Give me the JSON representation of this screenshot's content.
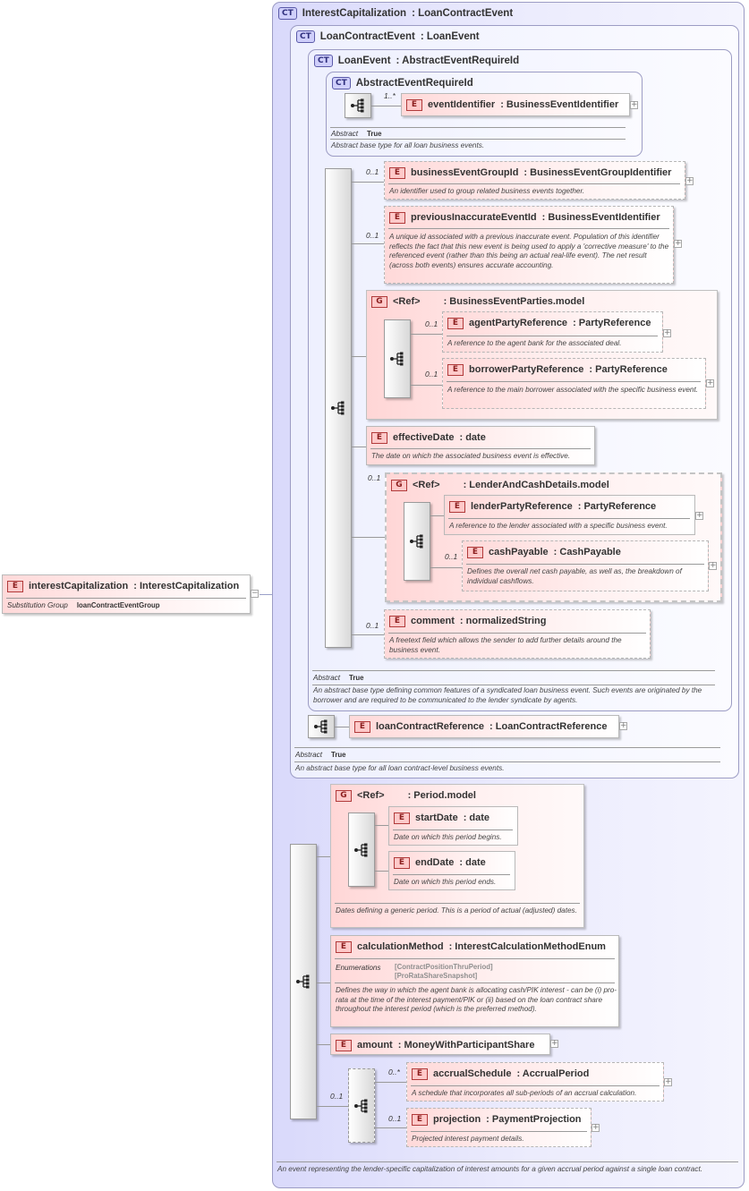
{
  "root": {
    "badge": "E",
    "name": "interestCapitalization",
    "type": ": InterestCapitalization",
    "subst_label": "Substitution Group",
    "subst_value": "loanContractEventGroup",
    "toggle": "−"
  },
  "ct_interest": {
    "badge": "CT",
    "name": "InterestCapitalization",
    "base": ": LoanContractEvent",
    "desc": "An event representing the lender-specific capitalization of interest amounts for a given accrual period against a single loan contract."
  },
  "ct_loancontract": {
    "badge": "CT",
    "name": "LoanContractEvent",
    "base": ": LoanEvent",
    "abstract_label": "Abstract",
    "abstract_value": "True",
    "desc": "An abstract base type for all loan contract-level business events."
  },
  "ct_loanevent": {
    "badge": "CT",
    "name": "LoanEvent",
    "base": ": AbstractEventRequireId",
    "abstract_label": "Abstract",
    "abstract_value": "True",
    "desc": "An abstract base type defining common features of a syndicated loan business event. Such events are originated by the borrower and are required to be communicated to the lender syndicate by agents."
  },
  "ct_abstract": {
    "badge": "CT",
    "name": "AbstractEventRequireId",
    "abstract_label": "Abstract",
    "abstract_value": "True",
    "desc": "Abstract base type for all loan business events."
  },
  "elements": {
    "eventIdentifier": {
      "badge": "E",
      "name": "eventIdentifier",
      "type": ": BusinessEventIdentifier",
      "card": "1..*"
    },
    "businessEventGroupId": {
      "badge": "E",
      "name": "businessEventGroupId",
      "type": ": BusinessEventGroupIdentifier",
      "card": "0..1",
      "desc": "An identifier used to group related business events together."
    },
    "previousInaccurateEventId": {
      "badge": "E",
      "name": "previousInaccurateEventId",
      "type": ": BusinessEventIdentifier",
      "card": "0..1",
      "desc": "A unique id associated with a previous inaccurate event. Population of this identifier reflects the fact that this new event is being used to apply a 'corrective measure' to the referenced event (rather than this being an actual real-life event). The net result (across both events) ensures accurate accounting."
    },
    "agentPartyReference": {
      "badge": "E",
      "name": "agentPartyReference",
      "type": ": PartyReference",
      "card": "0..1",
      "desc": "A reference to the agent bank for the associated deal."
    },
    "borrowerPartyReference": {
      "badge": "E",
      "name": "borrowerPartyReference",
      "type": ": PartyReference",
      "card": "0..1",
      "desc": "A reference to the main borrower associated with the specific business event."
    },
    "effectiveDate": {
      "badge": "E",
      "name": "effectiveDate",
      "type": ": date",
      "desc": "The date on which the associated business event is effective."
    },
    "lenderPartyReference": {
      "badge": "E",
      "name": "lenderPartyReference",
      "type": ": PartyReference",
      "desc": "A reference to the lender associated with a specific business event."
    },
    "cashPayable": {
      "badge": "E",
      "name": "cashPayable",
      "type": ": CashPayable",
      "card": "0..1",
      "desc": "Defines the overall net cash payable, as well as, the breakdown of individual cashflows."
    },
    "comment": {
      "badge": "E",
      "name": "comment",
      "type": ": normalizedString",
      "card": "0..1",
      "desc": "A freetext field which allows the sender to add further details around the business event."
    },
    "loanContractReference": {
      "badge": "E",
      "name": "loanContractReference",
      "type": ": LoanContractReference"
    },
    "startDate": {
      "badge": "E",
      "name": "startDate",
      "type": ": date",
      "desc": "Date on which this period begins."
    },
    "endDate": {
      "badge": "E",
      "name": "endDate",
      "type": ": date",
      "desc": "Date on which this period ends."
    },
    "calculationMethod": {
      "badge": "E",
      "name": "calculationMethod",
      "type": ": InterestCalculationMethodEnum",
      "enum_label": "Enumerations",
      "enum_values": [
        "[ContractPositionThruPeriod]",
        "[ProRataShareSnapshot]"
      ],
      "desc": "Defines the way in which the agent bank is allocating cash/PIK interest - can be (i) pro-rata at the time of the interest payment/PIK or (ii) based on the loan contract share throughout the interest period (which is the preferred method)."
    },
    "amount": {
      "badge": "E",
      "name": "amount",
      "type": ": MoneyWithParticipantShare"
    },
    "accrualSchedule": {
      "badge": "E",
      "name": "accrualSchedule",
      "type": ": AccrualPeriod",
      "card": "0..*",
      "desc": "A schedule that incorporates all sub-periods of an accrual calculation."
    },
    "projection": {
      "badge": "E",
      "name": "projection",
      "type": ": PaymentProjection",
      "card": "0..1",
      "desc": "Projected interest payment details."
    }
  },
  "groups": {
    "businessEventParties": {
      "badge": "G",
      "ref": "<Ref>",
      "name": ": BusinessEventParties.model"
    },
    "lenderAndCash": {
      "badge": "G",
      "ref": "<Ref>",
      "name": ": LenderAndCashDetails.model",
      "card": "0..1"
    },
    "period": {
      "badge": "G",
      "ref": "<Ref>",
      "name": ": Period.model",
      "desc": "Dates defining a generic period. This is a period of actual (adjusted) dates."
    }
  },
  "choice_card": "0..1",
  "icons": {
    "expand": "+",
    "sequence": "sequence-icon"
  },
  "colors": {
    "complex_type": "#ececfd",
    "element": "#ffe0e0",
    "group": "#ffe4e4"
  }
}
